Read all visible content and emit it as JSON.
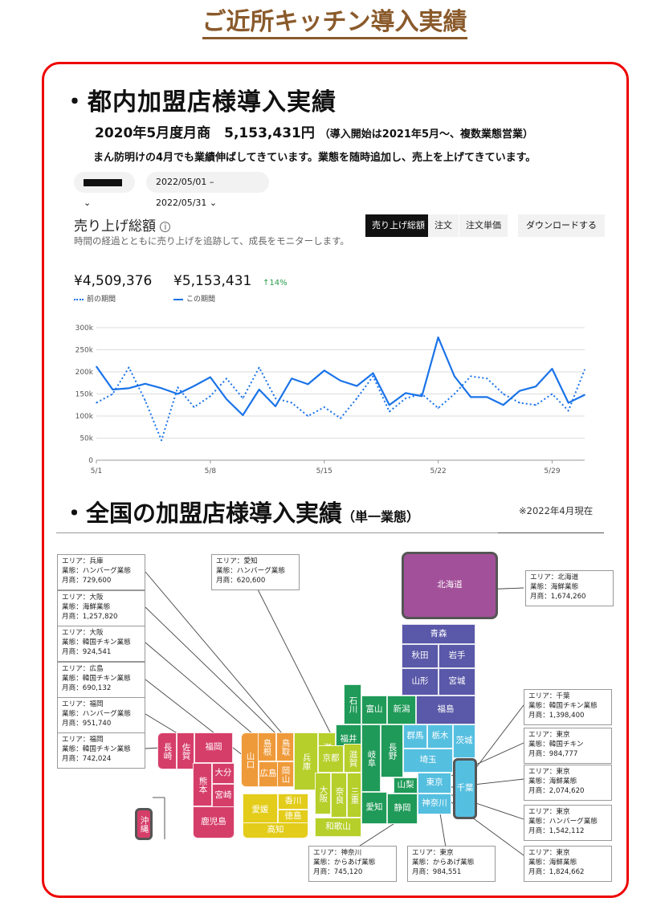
{
  "page_title": "ご近所キッチン導入実績",
  "section1": {
    "title": "・都内加盟店様導入実績",
    "sales_line": "2020年5月度月商　5,153,431円",
    "sales_note": "（導入開始は2021年5月～、複数業態営業）",
    "comment": "まん防明けの4月でも業績伸ばしてきています。業態を随時追加し、売上を上げてきています。"
  },
  "dashboard": {
    "store_selector_suffix": "⌄",
    "date_range": "2022/05/01 – 2022/05/31 ⌄",
    "chart_title": "売り上げ総額",
    "info_icon": "i",
    "chart_subtitle": "時間の経過とともに売り上げを追跡して、成長をモニターします。",
    "tabs": [
      "売り上げ総額",
      "注文",
      "注文単価"
    ],
    "download_label": "ダウンロードする",
    "prev_total": "¥4,509,376",
    "curr_total": "¥5,153,431",
    "change": "↑14%",
    "legend_prev": "前の期間",
    "legend_curr": "この期間",
    "colors": {
      "line": "#1a73e8",
      "up": "#2a9d4b"
    }
  },
  "chart_data": {
    "type": "line",
    "x": [
      1,
      2,
      3,
      4,
      5,
      6,
      7,
      8,
      9,
      10,
      11,
      12,
      13,
      14,
      15,
      16,
      17,
      18,
      19,
      20,
      21,
      22,
      23,
      24,
      25,
      26,
      27,
      28,
      29,
      30,
      31
    ],
    "tick_labels": [
      "5/1",
      "5/8",
      "5/15",
      "5/22",
      "5/29"
    ],
    "tick_positions": [
      1,
      8,
      15,
      22,
      29
    ],
    "ylim": [
      0,
      300000
    ],
    "y_ticks": [
      "0",
      "50k",
      "100k",
      "150k",
      "200k",
      "250k",
      "300k"
    ],
    "series": [
      {
        "name": "この期間",
        "style": "solid",
        "values": [
          212000,
          160000,
          163000,
          173000,
          163000,
          150000,
          168000,
          188000,
          138000,
          102000,
          160000,
          122000,
          185000,
          172000,
          203000,
          180000,
          168000,
          197000,
          125000,
          152000,
          145000,
          278000,
          190000,
          143000,
          143000,
          125000,
          157000,
          167000,
          207000,
          130000,
          148000
        ]
      },
      {
        "name": "前の期間",
        "style": "dotted",
        "values": [
          130000,
          150000,
          210000,
          135000,
          45000,
          165000,
          120000,
          145000,
          185000,
          140000,
          210000,
          140000,
          130000,
          100000,
          120000,
          95000,
          140000,
          190000,
          110000,
          140000,
          150000,
          118000,
          150000,
          190000,
          185000,
          150000,
          130000,
          125000,
          150000,
          112000,
          205000
        ]
      }
    ]
  },
  "section2": {
    "title": "・全国の加盟店様導入実績",
    "title_note": "（単一業態）",
    "as_of": "※2022年4月現在"
  },
  "info_boxes": [
    {
      "l1": "エリア：兵庫",
      "l2": "業態：ハンバーグ業態",
      "l3": "月商：729,600"
    },
    {
      "l1": "エリア：大阪",
      "l2": "業態：海鮮業態",
      "l3": "月商：1,257,820"
    },
    {
      "l1": "エリア：大阪",
      "l2": "業態：韓国チキン業態",
      "l3": "月商：924,541"
    },
    {
      "l1": "エリア：広島",
      "l2": "業態：韓国チキン業態",
      "l3": "月商：690,132"
    },
    {
      "l1": "エリア：福岡",
      "l2": "業態：ハンバーグ業態",
      "l3": "月商：951,740"
    },
    {
      "l1": "エリア：福岡",
      "l2": "業態：韓国チキン業態",
      "l3": "月商：742,024"
    },
    {
      "l1": "エリア：愛知",
      "l2": "業態：ハンバーグ業態",
      "l3": "月商：620,600"
    },
    {
      "l1": "エリア：北海道",
      "l2": "業態：海鮮業態",
      "l3": "月商：1,674,260"
    },
    {
      "l1": "エリア：千葉",
      "l2": "業態：韓国チキン業態",
      "l3": "月商：1,398,400"
    },
    {
      "l1": "エリア：東京",
      "l2": "業態：韓国チキン",
      "l3": "月商：984,777"
    },
    {
      "l1": "エリア：東京",
      "l2": "業態：海鮮業態",
      "l3": "月商：2,074,620"
    },
    {
      "l1": "エリア：東京",
      "l2": "業態：ハンバーグ業態",
      "l3": "月商：1,542,112"
    },
    {
      "l1": "エリア：東京",
      "l2": "業態：海鮮業態",
      "l3": "月商：1,824,662"
    },
    {
      "l1": "エリア：神奈川",
      "l2": "業態：からあげ業態",
      "l3": "月商：745,120"
    },
    {
      "l1": "エリア：東京",
      "l2": "業態：からあげ業態",
      "l3": "月商：984,551"
    }
  ],
  "map": {
    "colors": {
      "hokkaido": "#a3509a",
      "tohoku": "#5a58a8",
      "kanto": "#55bfe0",
      "chubu": "#1f9a58",
      "kinki": "#b6cf2a",
      "chugoku": "#ef9a3a",
      "shikoku": "#e3cc1a",
      "kyushu": "#d63e6a"
    },
    "prefs": {
      "hokkaido": "北海道",
      "aomori": "青森",
      "akita": "秋田",
      "iwate": "岩手",
      "yamagata": "山形",
      "miyagi": "宮城",
      "fukushima": "福島",
      "niigata": "新潟",
      "toyama": "富山",
      "ishikawa": "石川",
      "fukui": "福井",
      "nagano": "長野",
      "gifu": "岐阜",
      "yamanashi": "山梨",
      "shizuoka": "静岡",
      "aichi": "愛知",
      "gunma": "群馬",
      "tochigi": "栃木",
      "ibaraki": "茨城",
      "saitama": "埼玉",
      "tokyo": "東京",
      "kanagawa": "神奈川",
      "chiba": "千葉",
      "shiga": "滋賀",
      "kyoto": "京都",
      "hyogo": "兵庫",
      "osaka": "大阪",
      "nara": "奈良",
      "mie": "三重",
      "wakayama": "和歌山",
      "tottori": "鳥取",
      "shimane": "島根",
      "okayama": "岡山",
      "hiroshima": "広島",
      "yamaguchi": "山口",
      "kagawa": "香川",
      "ehime": "愛媛",
      "tokushima": "徳島",
      "kochi": "高知",
      "fukuoka": "福岡",
      "saga": "佐賀",
      "nagasaki": "長崎",
      "oita": "大分",
      "kumamoto": "熊本",
      "miyazaki": "宮崎",
      "kagoshima": "鹿児島",
      "okinawa": "沖縄"
    }
  }
}
